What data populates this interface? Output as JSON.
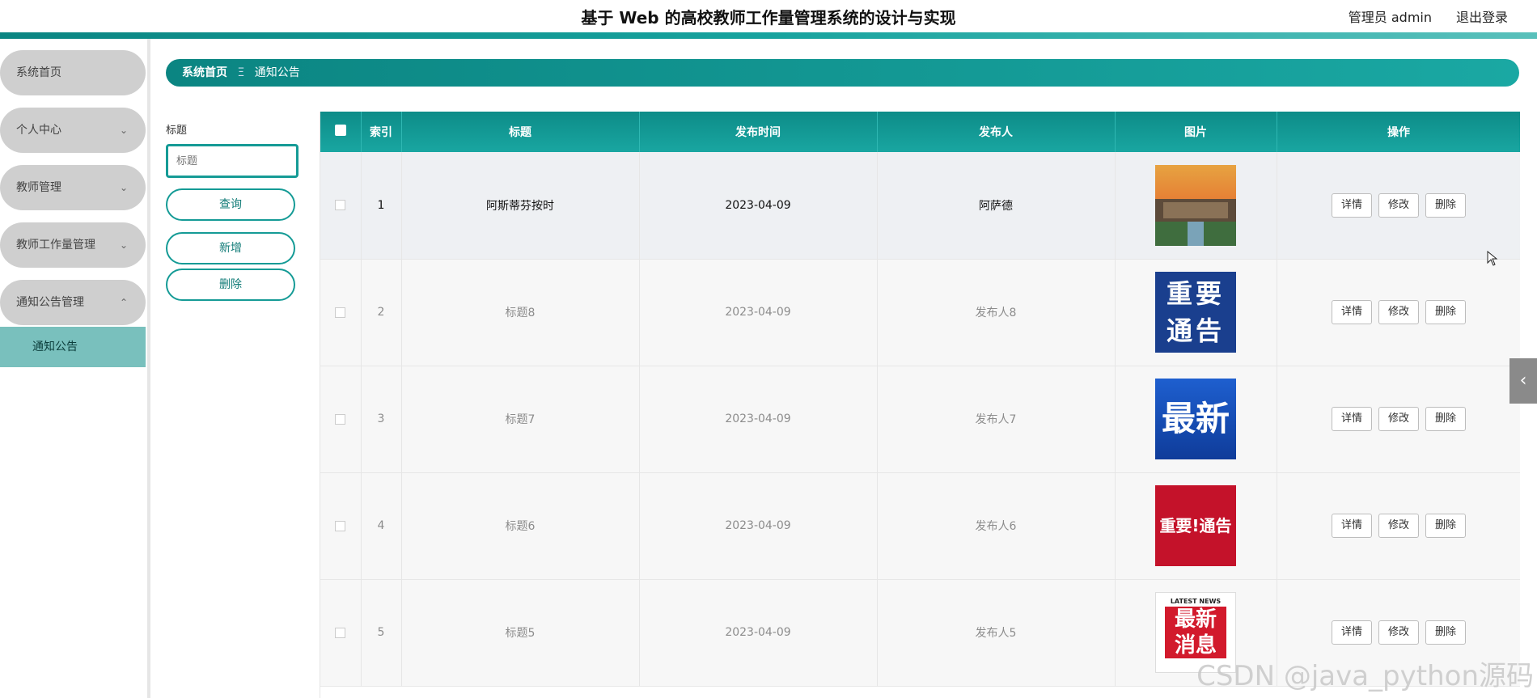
{
  "header": {
    "title": "基于 Web 的高校教师工作量管理系统的设计与实现",
    "user": "管理员 admin",
    "logout": "退出登录"
  },
  "sidebar": {
    "items": [
      {
        "label": "系统首页"
      },
      {
        "label": "个人中心"
      },
      {
        "label": "教师管理"
      },
      {
        "label": "教师工作量管理"
      },
      {
        "label": "通知公告管理"
      }
    ],
    "sub_item": "通知公告"
  },
  "breadcrumb": {
    "home": "系统首页",
    "separator": "Ξ",
    "current": "通知公告"
  },
  "search": {
    "label": "标题",
    "placeholder": "标题",
    "query_button": "查询",
    "add_button": "新增",
    "delete_button": "删除"
  },
  "table": {
    "columns": [
      "索引",
      "标题",
      "发布时间",
      "发布人",
      "图片",
      "操作"
    ],
    "rows": [
      {
        "index": "1",
        "title": "阿斯蒂芬按时",
        "date": "2023-04-09",
        "publisher": "阿萨德",
        "image": "campus-photo"
      },
      {
        "index": "2",
        "title": "标题8",
        "date": "2023-04-09",
        "publisher": "发布人8",
        "image": "notice-image-important",
        "img_text": "重要通告"
      },
      {
        "index": "3",
        "title": "标题7",
        "date": "2023-04-09",
        "publisher": "发布人7",
        "image": "notice-image-latest",
        "img_text": "最新"
      },
      {
        "index": "4",
        "title": "标题6",
        "date": "2023-04-09",
        "publisher": "发布人6",
        "image": "notice-image-important-red",
        "img_text": "重要!通告"
      },
      {
        "index": "5",
        "title": "标题5",
        "date": "2023-04-09",
        "publisher": "发布人5",
        "image": "notice-image-latest-news",
        "img_text": "最新消息",
        "img_subtext": "LATEST NEWS"
      }
    ],
    "actions": {
      "detail": "详情",
      "edit": "修改",
      "delete": "删除"
    }
  },
  "watermark": "CSDN @java_python源码",
  "colors": {
    "accent": "#159b96",
    "sidebar_item": "#cfcfcf",
    "sidebar_active": "#79c0bd"
  }
}
